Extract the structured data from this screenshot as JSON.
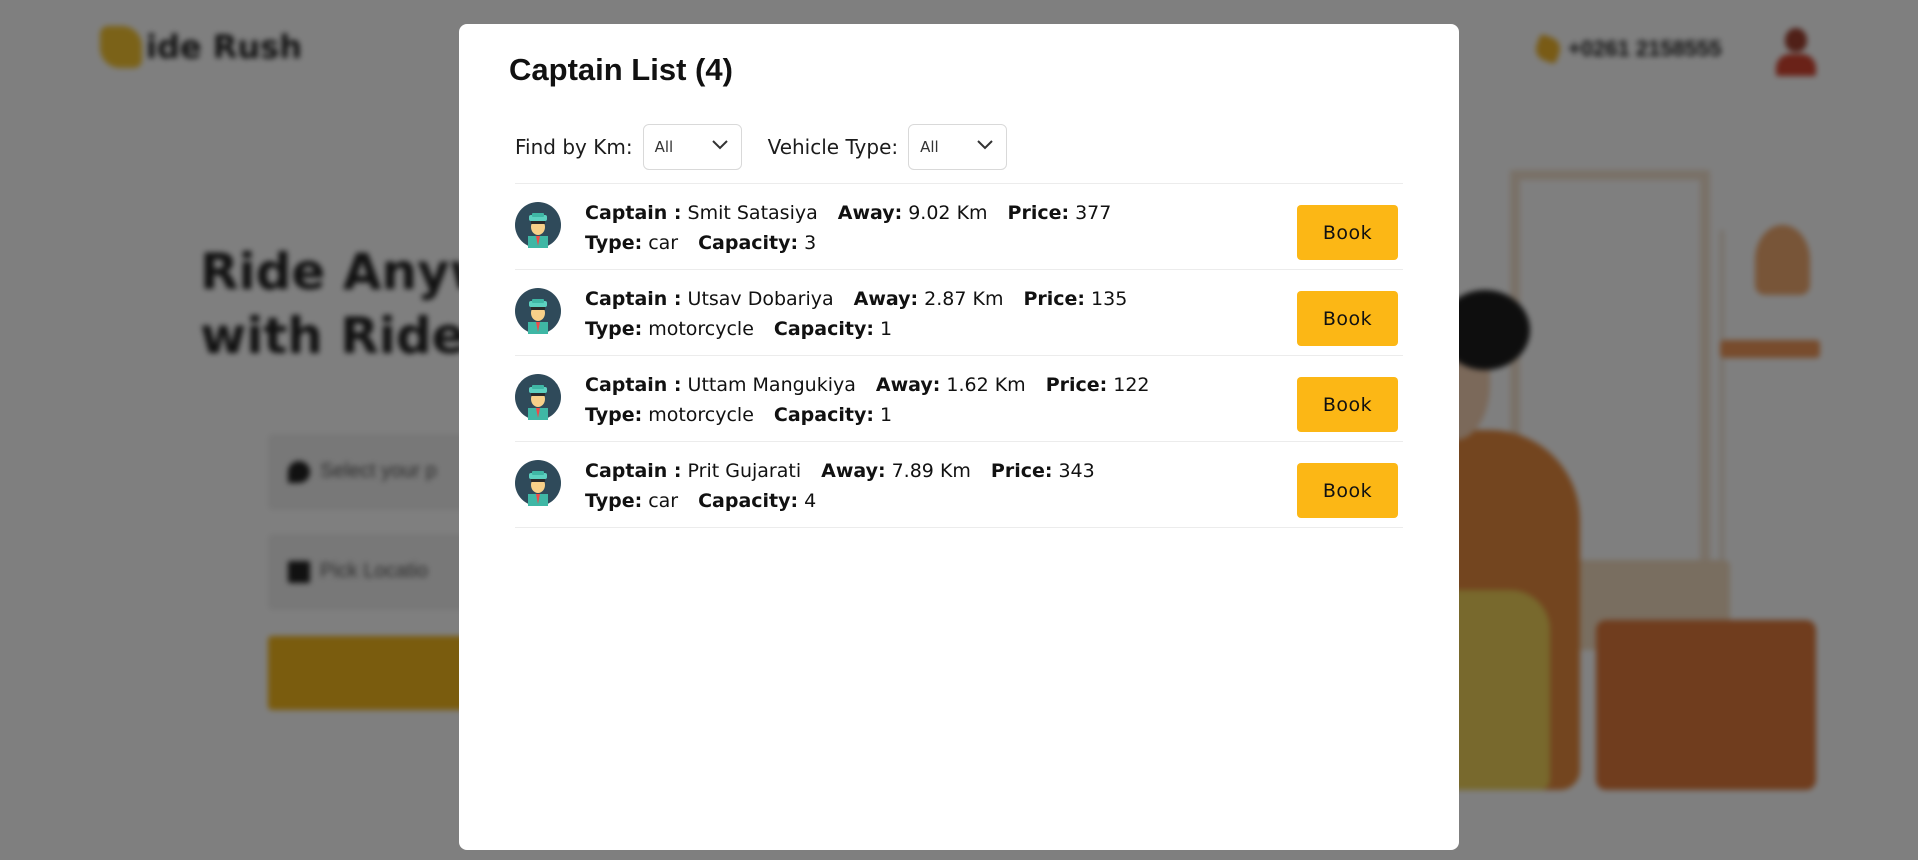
{
  "background": {
    "logo_text": "ide Rush",
    "phone_text": "+0261 2158555",
    "hero_title": [
      "Ride Anywh",
      "with Ride R"
    ],
    "inputs": [
      "Select your p",
      "Pick Locatio"
    ]
  },
  "modal": {
    "title": "Captain List (4)",
    "filters": {
      "km_label": "Find by Km:",
      "km_value": "All",
      "vehicle_label": "Vehicle Type:",
      "vehicle_value": "All"
    },
    "labels": {
      "captain": "Captain :",
      "away": "Away:",
      "price": "Price:",
      "type": "Type:",
      "capacity": "Capacity:"
    },
    "captains": [
      {
        "name": "Smit Satasiya",
        "away": "9.02 Km",
        "price": "377",
        "type": "car",
        "capacity": "3",
        "book": "Book"
      },
      {
        "name": "Utsav Dobariya",
        "away": "2.87 Km",
        "price": "135",
        "type": "motorcycle",
        "capacity": "1",
        "book": "Book"
      },
      {
        "name": "Uttam Mangukiya",
        "away": "1.62 Km",
        "price": "122",
        "type": "motorcycle",
        "capacity": "1",
        "book": "Book"
      },
      {
        "name": "Prit Gujarati",
        "away": "7.89 Km",
        "price": "343",
        "type": "car",
        "capacity": "4",
        "book": "Book"
      }
    ]
  },
  "colors": {
    "accent": "#fcb715",
    "overlay": "rgba(0,0,0,0.5)"
  },
  "icons": {
    "captain_avatar": "captain-avatar-icon",
    "select_chevron": "chevron-down-icon"
  }
}
